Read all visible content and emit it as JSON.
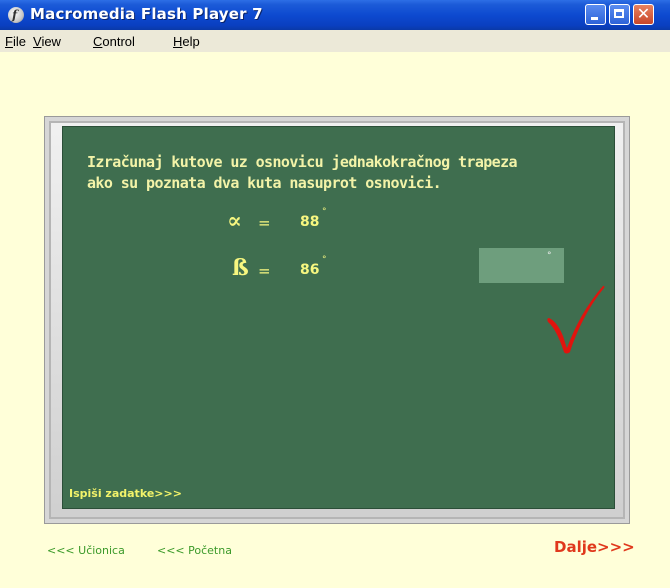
{
  "window": {
    "title": "Macromedia Flash Player 7",
    "buttons": [
      "minimize",
      "maximize",
      "close"
    ]
  },
  "menu": {
    "items": [
      {
        "mnemonic": "F",
        "rest": "ile"
      },
      {
        "mnemonic": "V",
        "rest": "iew"
      },
      {
        "mnemonic": "C",
        "rest": "ontrol"
      },
      {
        "mnemonic": "H",
        "rest": "elp"
      }
    ]
  },
  "board": {
    "task_line1": "Izračunaj kutove uz osnovicu jednakokračnog trapeza",
    "task_line2": "ako su poznata dva kuta nasuprot osnovici.",
    "alpha": {
      "symbol": "∝",
      "eq": "=",
      "value": "88",
      "unit": "°"
    },
    "beta": {
      "symbol": "ß",
      "eq": "=",
      "value": "86",
      "unit": "°"
    },
    "answer": {
      "value": "",
      "unit": "°"
    },
    "print_link": "Ispiši zadatke>>>",
    "status_icon": "checkmark-icon"
  },
  "footer": {
    "classroom_link": "<<< Učionica",
    "home_link": "<<< Početna",
    "next_link": "Dalje>>>"
  },
  "colors": {
    "background": "#ffffd9",
    "board": "#3f6e4f",
    "chalk_text": "#f3f3a8",
    "answer_box": "#6e9e7d",
    "checkmark": "#e0140e",
    "nav_green": "#3b9a2a",
    "next_red": "#e0381c"
  }
}
